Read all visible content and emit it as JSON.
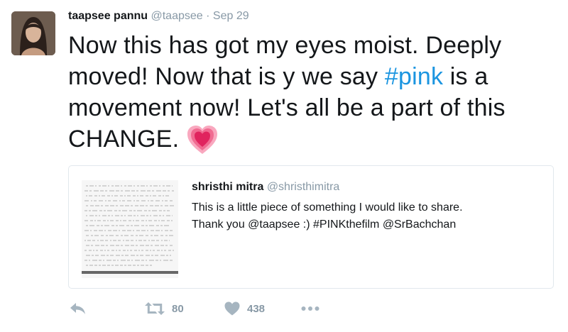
{
  "tweet": {
    "author_name": "taapsee pannu",
    "author_handle": "@taapsee",
    "separator": "·",
    "date": "Sep 29",
    "text_before": "Now this has got my eyes moist. Deeply moved! Now that is y we say ",
    "hashtag": "#pink",
    "text_after": " is a movement now! Let's all be a part of this CHANGE.",
    "emoji_icon": "sparkling-heart-icon"
  },
  "quoted_tweet": {
    "author_name": "shristhi mitra",
    "author_handle": "@shristhimitra",
    "text_line1": "This is a little piece of something I would like to share.",
    "text_line2": "Thank you @taapsee :) #PINKthefilm  @SrBachchan"
  },
  "actions": {
    "reply_icon": "reply-icon",
    "retweet_icon": "retweet-icon",
    "retweet_count": "80",
    "like_icon": "heart-icon",
    "like_count": "438",
    "more_icon": "more-icon"
  },
  "colors": {
    "link": "#1b95e0",
    "muted": "#8899a6",
    "icon": "#a6b5c0",
    "heart_emoji": "#e0245e"
  }
}
